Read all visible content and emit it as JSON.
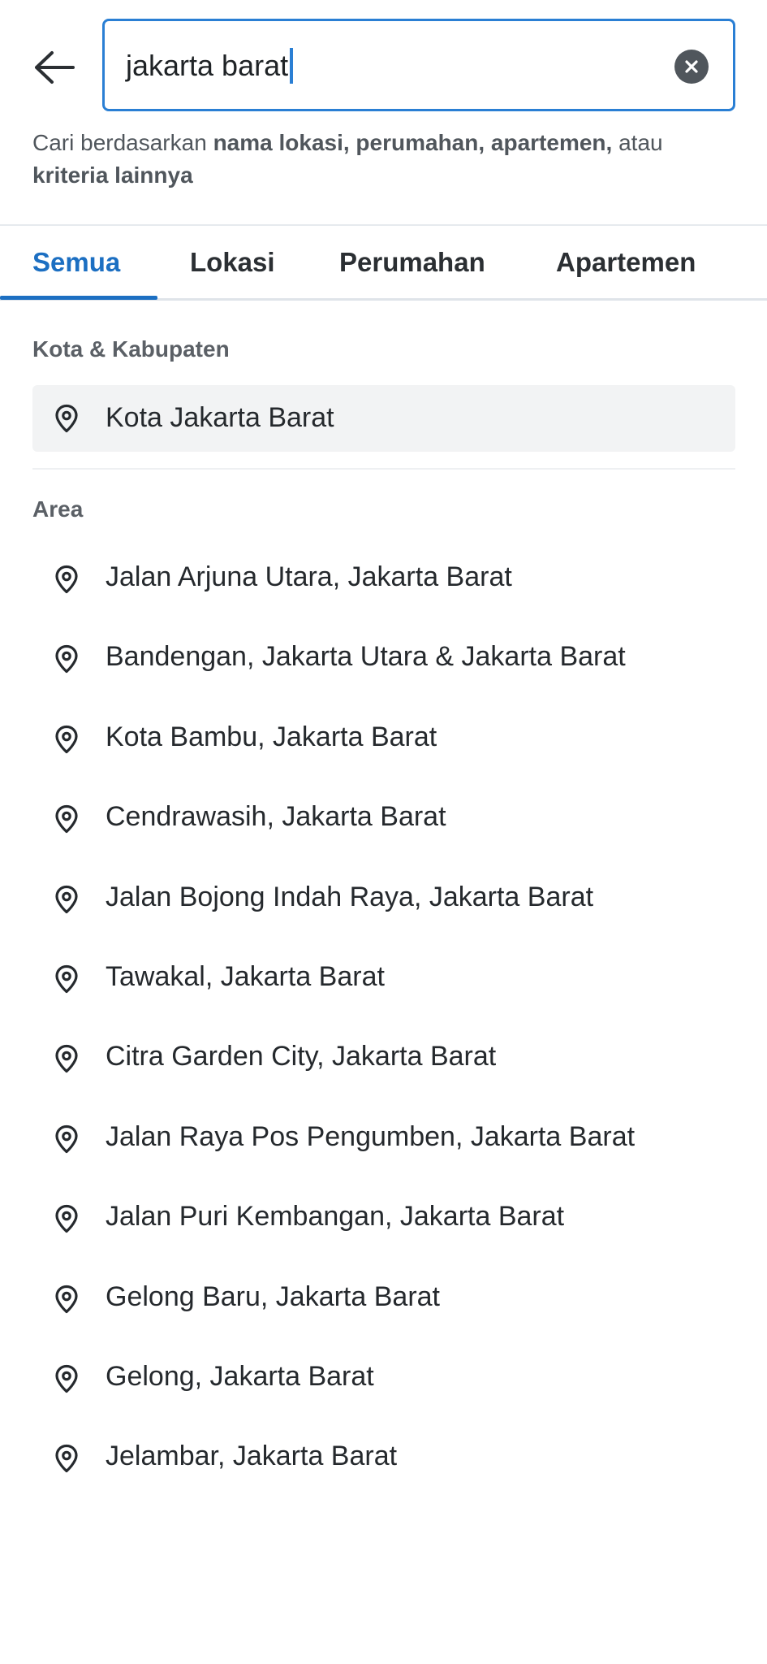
{
  "search": {
    "value": "jakarta barat"
  },
  "hint": {
    "prefix": "Cari berdasarkan ",
    "bold1": "nama lokasi, perumahan, apartemen,",
    "middle": " atau ",
    "bold2": "kriteria lainnya"
  },
  "tabs": [
    {
      "label": "Semua",
      "active": true
    },
    {
      "label": "Lokasi",
      "active": false
    },
    {
      "label": "Perumahan",
      "active": false
    },
    {
      "label": "Apartemen",
      "active": false
    }
  ],
  "sections": {
    "city_title": "Kota & Kabupaten",
    "city_items": [
      "Kota Jakarta Barat"
    ],
    "area_title": "Area",
    "area_items": [
      "Jalan Arjuna Utara, Jakarta Barat",
      "Bandengan, Jakarta Utara & Jakarta Barat",
      "Kota Bambu, Jakarta Barat",
      "Cendrawasih, Jakarta Barat",
      "Jalan Bojong Indah Raya, Jakarta Barat",
      "Tawakal, Jakarta Barat",
      "Citra Garden City, Jakarta Barat",
      "Jalan Raya Pos Pengumben, Jakarta Barat",
      "Jalan Puri Kembangan, Jakarta Barat",
      "Gelong Baru, Jakarta Barat",
      "Gelong, Jakarta Barat",
      "Jelambar, Jakarta Barat"
    ]
  },
  "icons": {
    "back": "arrow-left-icon",
    "clear": "close-circle-icon",
    "location": "location-pin-icon"
  },
  "colors": {
    "accent": "#1c6fc2",
    "input_border": "#2a7fd4",
    "text": "#2b2f33",
    "muted": "#5b6066",
    "selected_bg": "#f2f3f4"
  }
}
